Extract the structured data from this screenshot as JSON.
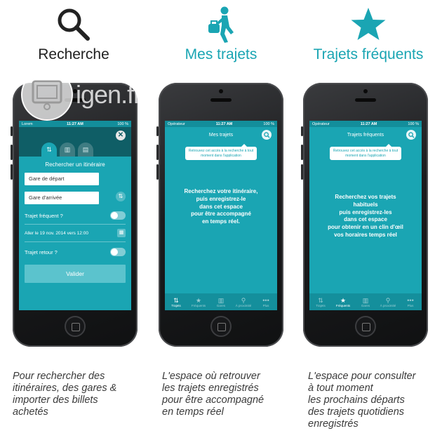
{
  "features": [
    {
      "title": "Recherche",
      "icon": "search-icon"
    },
    {
      "title": "Mes trajets",
      "icon": "traveler-icon"
    },
    {
      "title": "Trajets fréquents",
      "icon": "star-icon"
    }
  ],
  "colors": {
    "accent": "#1aa5b3",
    "dark_teal": "#0f5e66",
    "tabbar": "#148f9c"
  },
  "status": {
    "carrier1": "Lorem",
    "carrier2": "Opérateur",
    "time": "11:27 AM",
    "battery": "100 %"
  },
  "search": {
    "close": "✕",
    "title": "Rechercher un itinéraire",
    "departure": "Gare de départ",
    "arrival": "Gare d'arrivée",
    "frequent": "Trajet fréquent ?",
    "date": "Aller le 19 nov. 2014 vers 12:00",
    "return": "Trajet retour ?",
    "submit": "Valider"
  },
  "screen2": {
    "title": "Mes trajets",
    "bubble": "Retrouvez cet accès à la recherche à tout moment dans l'application",
    "promo": "Recherchez votre itinéraire,\npuis enregistrez-le\ndans cet espace\npour être accompagné\nen temps réel."
  },
  "screen3": {
    "title": "Trajets fréquents",
    "bubble": "Retrouvez cet accès à la recherche à tout moment dans l'application",
    "promo": "Recherchez vos trajets\nhabituels\npuis enregistrez-les\ndans cet espace\npour obtenir en un clin d'œil\nvos horaires temps réel"
  },
  "tabs": [
    "Trajets",
    "Fréquents",
    "Gares",
    "À proximité",
    "Plus"
  ],
  "captions": [
    "Pour rechercher des\nitinéraires, des gares &\nimporter des billets\nachetés",
    "L'espace où retrouver\nles trajets enregistrés\npour être accompagné\nen temps réel",
    "L'espace pour consulter\nà tout moment\nles prochains départs\ndes trajets quotidiens\nenregistrés"
  ],
  "watermark": "igen.fr"
}
